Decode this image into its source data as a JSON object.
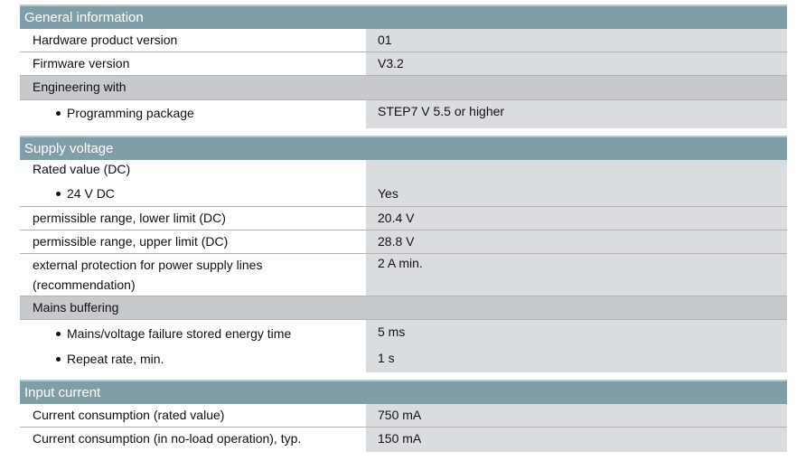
{
  "sections": [
    {
      "title": "General information",
      "rows": [
        {
          "label": "Hardware product version",
          "value": "01"
        },
        {
          "label": "Firmware version",
          "value": "V3.2"
        },
        {
          "label": "Engineering with",
          "value": "",
          "group": true
        },
        {
          "label": "Programming package",
          "value": "STEP7 V 5.5 or higher",
          "bullet": true
        }
      ]
    },
    {
      "title": "Supply voltage",
      "rows": [
        {
          "label": "Rated value (DC)",
          "value": ""
        },
        {
          "label": "24 V DC",
          "value": "Yes",
          "bullet": true
        },
        {
          "label": "permissible range, lower limit (DC)",
          "value": "20.4 V"
        },
        {
          "label": "permissible range, upper limit (DC)",
          "value": "28.8 V"
        },
        {
          "label": "external protection for power supply lines",
          "label2": "(recommendation)",
          "value": "2 A min."
        },
        {
          "label": "Mains buffering",
          "value": "",
          "group": true
        },
        {
          "label": "Mains/voltage failure stored energy time",
          "value": "5 ms",
          "bullet": true
        },
        {
          "label": "Repeat rate, min.",
          "value": "1 s",
          "bullet": true
        }
      ]
    },
    {
      "title": "Input current",
      "rows": [
        {
          "label": "Current consumption (rated value)",
          "value": "750 mA"
        },
        {
          "label": "Current consumption (in no-load operation), typ.",
          "value": "150 mA"
        }
      ]
    }
  ]
}
